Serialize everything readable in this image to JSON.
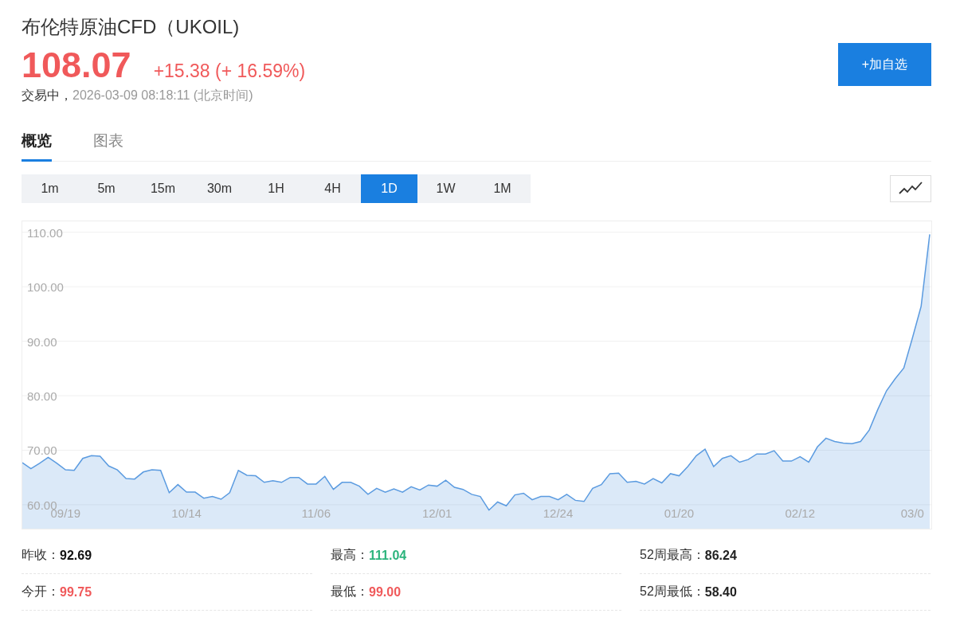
{
  "header": {
    "title": "布伦特原油CFD（UKOIL)",
    "price": "108.07",
    "change": "+15.38 (+ 16.59%)",
    "status": "交易中，",
    "time": "2026-03-09 08:18:11  (北京时间)",
    "add_button": "+加自选"
  },
  "tabs": [
    {
      "label": "概览",
      "selected": true
    },
    {
      "label": "图表",
      "selected": false
    }
  ],
  "periods": [
    {
      "label": "1m",
      "selected": false
    },
    {
      "label": "5m",
      "selected": false
    },
    {
      "label": "15m",
      "selected": false
    },
    {
      "label": "30m",
      "selected": false
    },
    {
      "label": "1H",
      "selected": false
    },
    {
      "label": "4H",
      "selected": false
    },
    {
      "label": "1D",
      "selected": true
    },
    {
      "label": "1W",
      "selected": false
    },
    {
      "label": "1M",
      "selected": false
    }
  ],
  "chart": {
    "chart_data": {
      "type": "area",
      "grid": true,
      "categories": [
        null,
        null,
        null,
        null,
        null,
        "09/19",
        null,
        null,
        null,
        null,
        null,
        null,
        null,
        null,
        null,
        null,
        null,
        null,
        null,
        "10/14",
        null,
        null,
        null,
        null,
        null,
        null,
        null,
        null,
        null,
        null,
        null,
        null,
        null,
        null,
        "11/06",
        null,
        null,
        null,
        null,
        null,
        null,
        null,
        null,
        null,
        null,
        null,
        null,
        null,
        "12/01",
        null,
        null,
        null,
        null,
        null,
        null,
        null,
        null,
        null,
        null,
        null,
        null,
        null,
        "12/24",
        null,
        null,
        null,
        null,
        null,
        null,
        null,
        null,
        null,
        null,
        null,
        null,
        null,
        "01/20",
        null,
        null,
        null,
        null,
        null,
        null,
        null,
        null,
        null,
        null,
        null,
        null,
        null,
        "02/12",
        null,
        null,
        null,
        null,
        null,
        null,
        null,
        null,
        null,
        null,
        null,
        null,
        "03/0",
        null,
        null
      ],
      "series": [
        {
          "color": "#5b9be0",
          "values": [
            67.7,
            66.6,
            67.6,
            68.7,
            67.6,
            66.4,
            66.3,
            68.5,
            69.0,
            68.9,
            67.1,
            66.4,
            64.8,
            64.7,
            66.0,
            66.4,
            66.3,
            62.2,
            63.7,
            62.3,
            62.3,
            61.2,
            61.5,
            61.0,
            62.2,
            66.3,
            65.4,
            65.3,
            64.1,
            64.4,
            64.1,
            65.0,
            65.0,
            63.8,
            63.8,
            65.2,
            62.8,
            64.1,
            64.1,
            63.4,
            61.9,
            63.0,
            62.3,
            62.9,
            62.3,
            63.3,
            62.7,
            63.6,
            63.4,
            64.5,
            63.2,
            62.8,
            61.9,
            61.5,
            59.0,
            60.5,
            59.8,
            61.8,
            62.1,
            60.9,
            61.5,
            61.5,
            60.9,
            61.9,
            60.8,
            60.6,
            63.0,
            63.7,
            65.7,
            65.8,
            64.1,
            64.3,
            63.8,
            64.8,
            64.0,
            65.7,
            65.3,
            67.0,
            69.0,
            70.2,
            67.0,
            68.5,
            69.0,
            67.8,
            68.3,
            69.3,
            69.3,
            69.9,
            68.0,
            68.0,
            68.8,
            67.8,
            70.6,
            72.2,
            71.6,
            71.3,
            71.2,
            71.6,
            73.7,
            77.5,
            80.9,
            83.1,
            85.1,
            90.6,
            96.4,
            109.6
          ]
        }
      ],
      "ylim": [
        55.6,
        112
      ],
      "yticks": [
        {
          "value": 60,
          "label": "60.00"
        },
        {
          "value": 70,
          "label": "70.00"
        },
        {
          "value": 80,
          "label": "80.00"
        },
        {
          "value": 90,
          "label": "90.00"
        },
        {
          "value": 100,
          "label": "100.00"
        },
        {
          "value": 110,
          "label": "110.00"
        }
      ]
    }
  },
  "stats": [
    {
      "label": "昨收：",
      "value": "92.69",
      "color": "#111111"
    },
    {
      "label": "最高：",
      "value": "111.04",
      "color": "#2db47d"
    },
    {
      "label": "52周最高：",
      "value": "86.24",
      "color": "#222222"
    },
    {
      "label": "今开：",
      "value": "99.75",
      "color": "#f0595a"
    },
    {
      "label": "最低：",
      "value": "99.00",
      "color": "#f0595a"
    },
    {
      "label": "52周最低：",
      "value": "58.40",
      "color": "#222222"
    }
  ]
}
